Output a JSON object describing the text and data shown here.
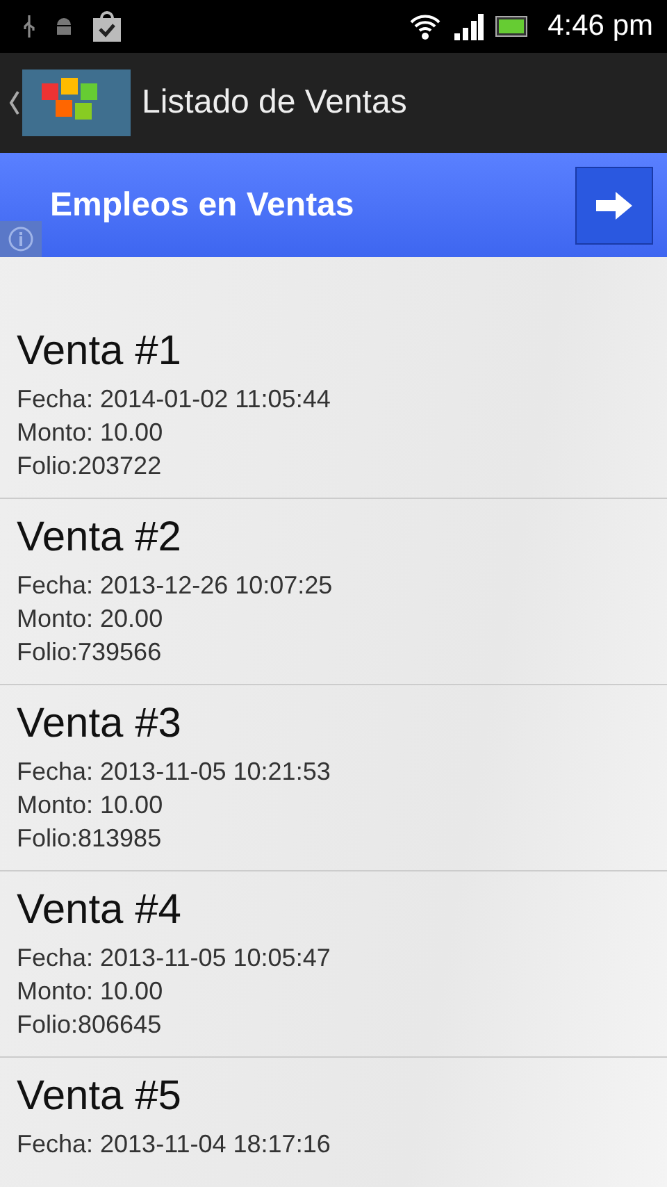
{
  "status_bar": {
    "time": "4:46 pm"
  },
  "action_bar": {
    "title": "Listado de Ventas"
  },
  "banner": {
    "title": "Empleos en Ventas"
  },
  "sales": [
    {
      "title": "Venta #1",
      "lines": [
        "Fecha: 2014-01-02 11:05:44",
        "Monto: 10.00",
        "Folio:203722"
      ]
    },
    {
      "title": "Venta #2",
      "lines": [
        "Fecha: 2013-12-26 10:07:25",
        "Monto: 20.00",
        "Folio:739566"
      ]
    },
    {
      "title": "Venta #3",
      "lines": [
        "Fecha: 2013-11-05 10:21:53",
        "Monto: 10.00",
        "Folio:813985"
      ]
    },
    {
      "title": "Venta #4",
      "lines": [
        "Fecha: 2013-11-05 10:05:47",
        "Monto: 10.00",
        "Folio:806645"
      ]
    },
    {
      "title": "Venta #5",
      "lines": [
        "Fecha: 2013-11-04 18:17:16"
      ]
    }
  ]
}
